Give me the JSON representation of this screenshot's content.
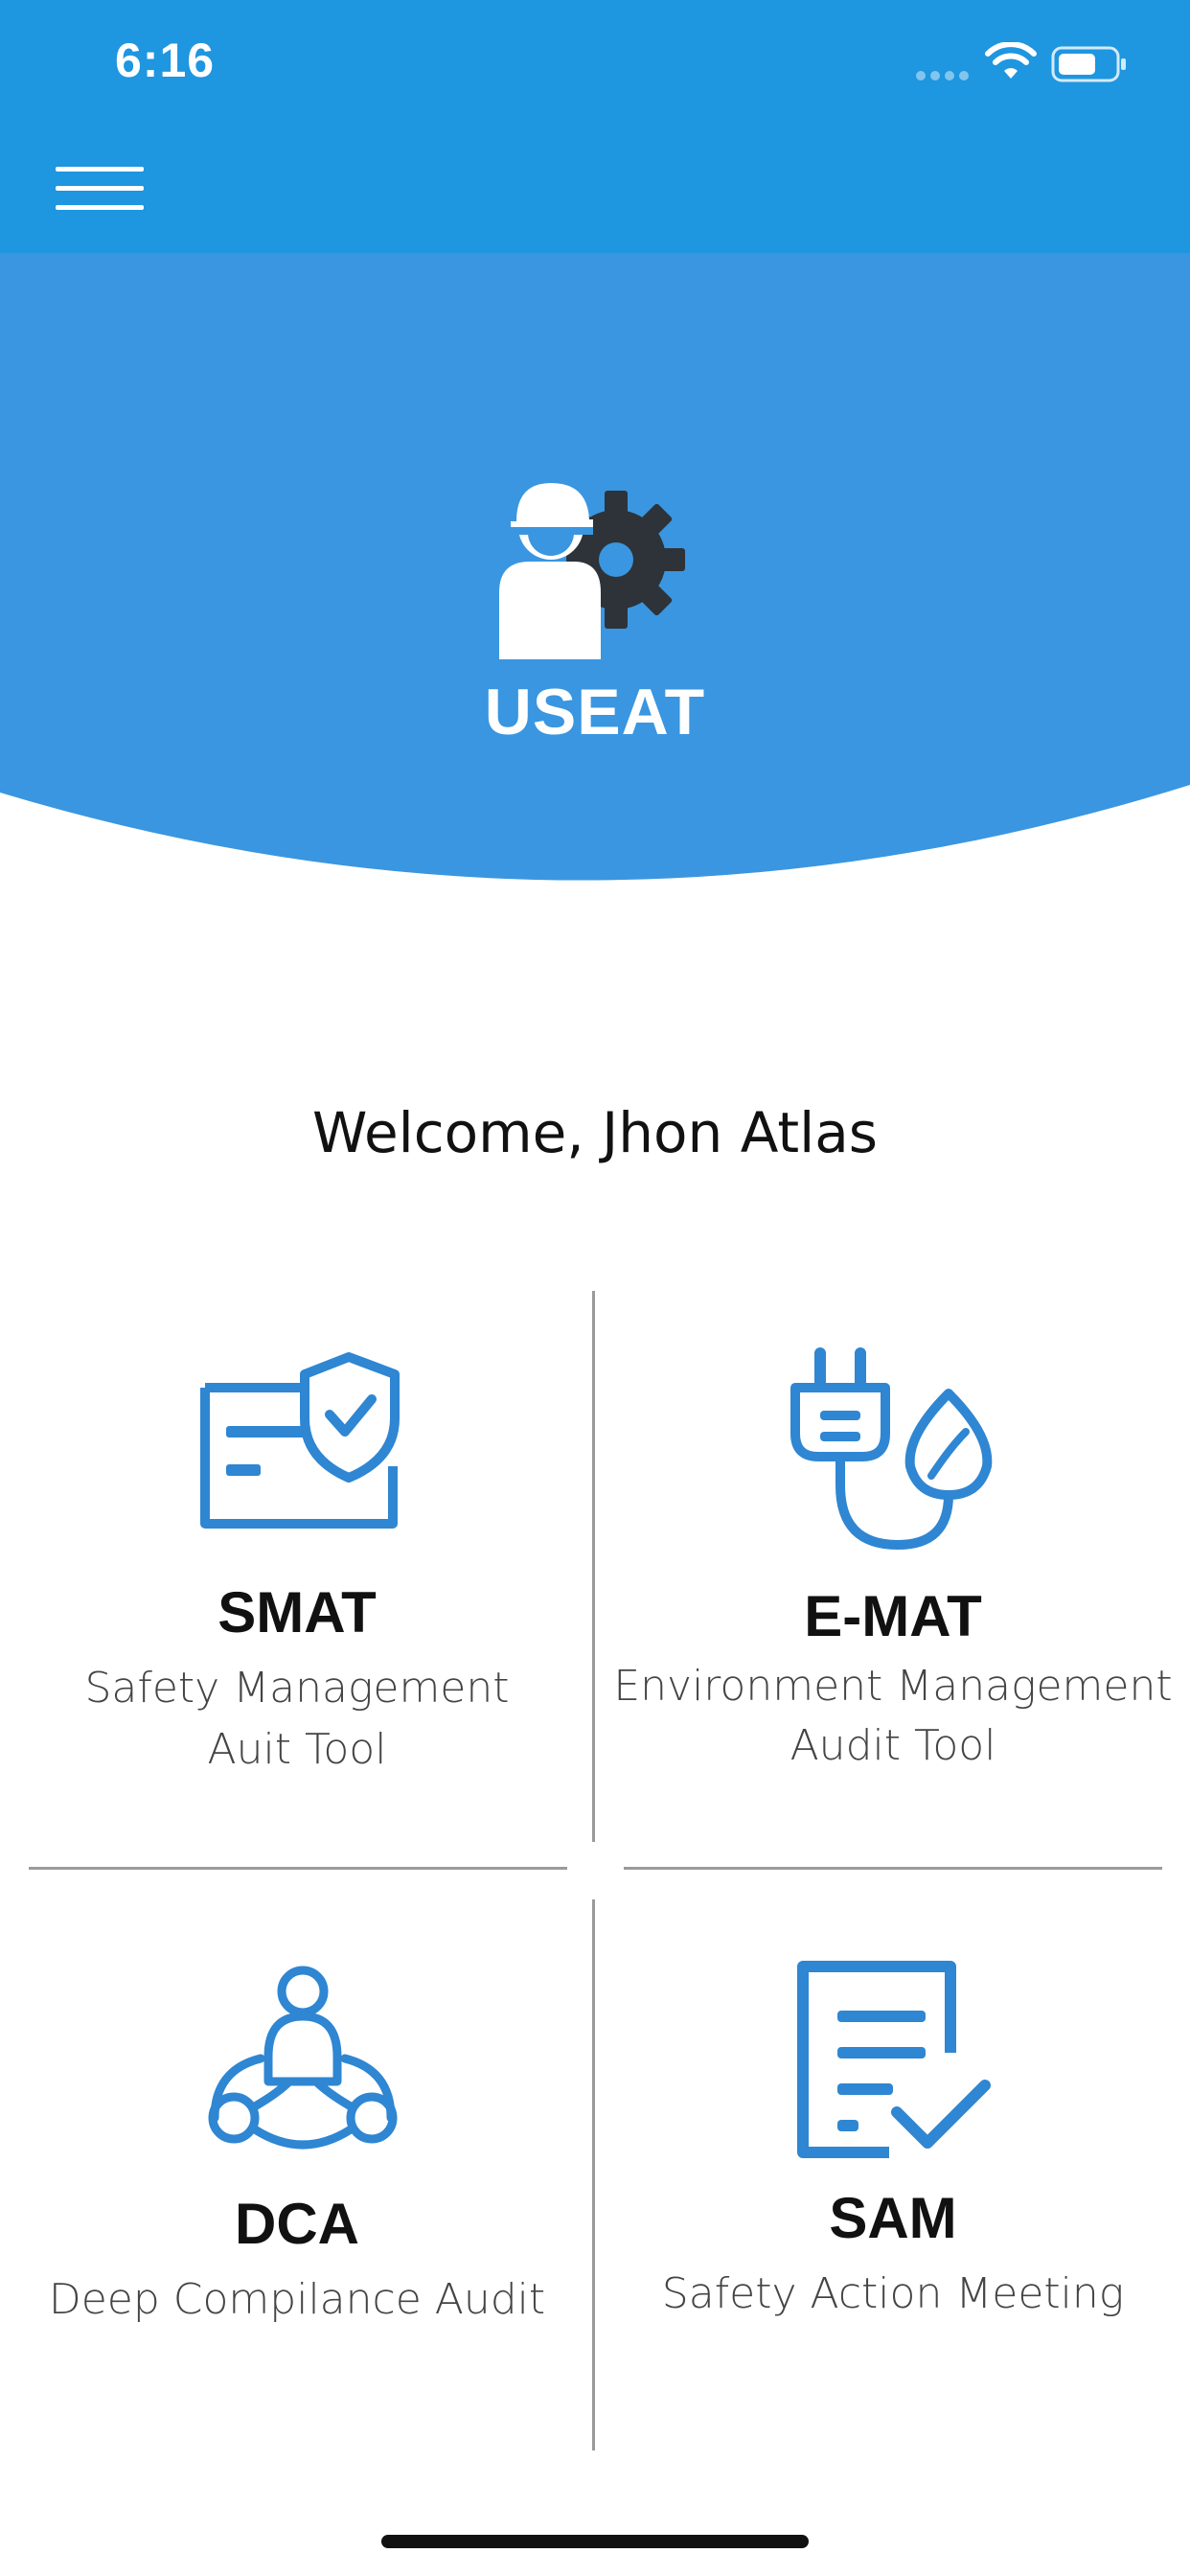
{
  "status_bar": {
    "time": "6:16"
  },
  "nav": {
    "menu_icon": "hamburger-icon"
  },
  "hero": {
    "logo_icon": "worker-gear-icon",
    "title": "USEAT"
  },
  "welcome": "Welcome, Jhon Atlas",
  "tiles": [
    {
      "icon": "shield-document-icon",
      "title": "SMAT",
      "subtitle_line1": "Safety Management",
      "subtitle_line2": "Auit Tool"
    },
    {
      "icon": "plug-leaf-icon",
      "title": "E-MAT",
      "subtitle_line1": "Environment Management",
      "subtitle_line2": "Audit Tool"
    },
    {
      "icon": "team-network-icon",
      "title": "DCA",
      "subtitle_line1": "Deep Compilance Audit",
      "subtitle_line2": ""
    },
    {
      "icon": "checklist-icon",
      "title": "SAM",
      "subtitle_line1": "Safety Action Meeting",
      "subtitle_line2": ""
    }
  ],
  "colors": {
    "topbar": "#1e96e0",
    "hero": "#3a96e0",
    "icon_blue": "#2f86d2",
    "gear": "#2d3338"
  }
}
